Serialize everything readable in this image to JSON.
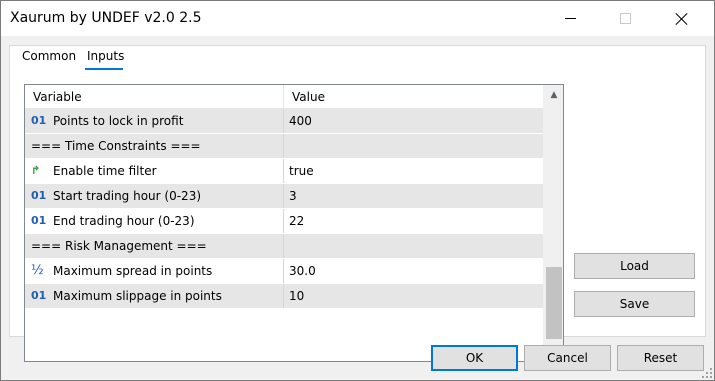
{
  "window": {
    "title": "Xaurum by UNDEF v2.0 2.5"
  },
  "tabs": [
    {
      "label": "Common",
      "active": false
    },
    {
      "label": "Inputs",
      "active": true
    }
  ],
  "grid": {
    "columns": [
      "Variable",
      "Value"
    ],
    "rows": [
      {
        "icon": "int-icon",
        "icon_glyph": "01",
        "variable": "Points to lock in profit",
        "value": "400"
      },
      {
        "icon": "",
        "icon_glyph": "",
        "variable": "=== Time Constraints ===",
        "value": ""
      },
      {
        "icon": "bool-arrow-icon",
        "icon_glyph": "↱",
        "variable": "Enable time filter",
        "value": "true"
      },
      {
        "icon": "int-icon",
        "icon_glyph": "01",
        "variable": "Start trading hour (0-23)",
        "value": "3"
      },
      {
        "icon": "int-icon",
        "icon_glyph": "01",
        "variable": "End trading hour (0-23)",
        "value": "22"
      },
      {
        "icon": "",
        "icon_glyph": "",
        "variable": "=== Risk Management ===",
        "value": ""
      },
      {
        "icon": "fraction-icon",
        "icon_glyph": "½",
        "variable": "Maximum spread in points",
        "value": "30.0"
      },
      {
        "icon": "int-icon",
        "icon_glyph": "01",
        "variable": "Maximum slippage in points",
        "value": "10"
      }
    ]
  },
  "side_buttons": {
    "load": "Load",
    "save": "Save"
  },
  "footer_buttons": {
    "ok": "OK",
    "cancel": "Cancel",
    "reset": "Reset"
  },
  "colors": {
    "accent": "#0078d7",
    "row_shade": "#e6e6e6",
    "int_icon": "#1e5fb4",
    "bool_icon": "#2a9a3a"
  }
}
